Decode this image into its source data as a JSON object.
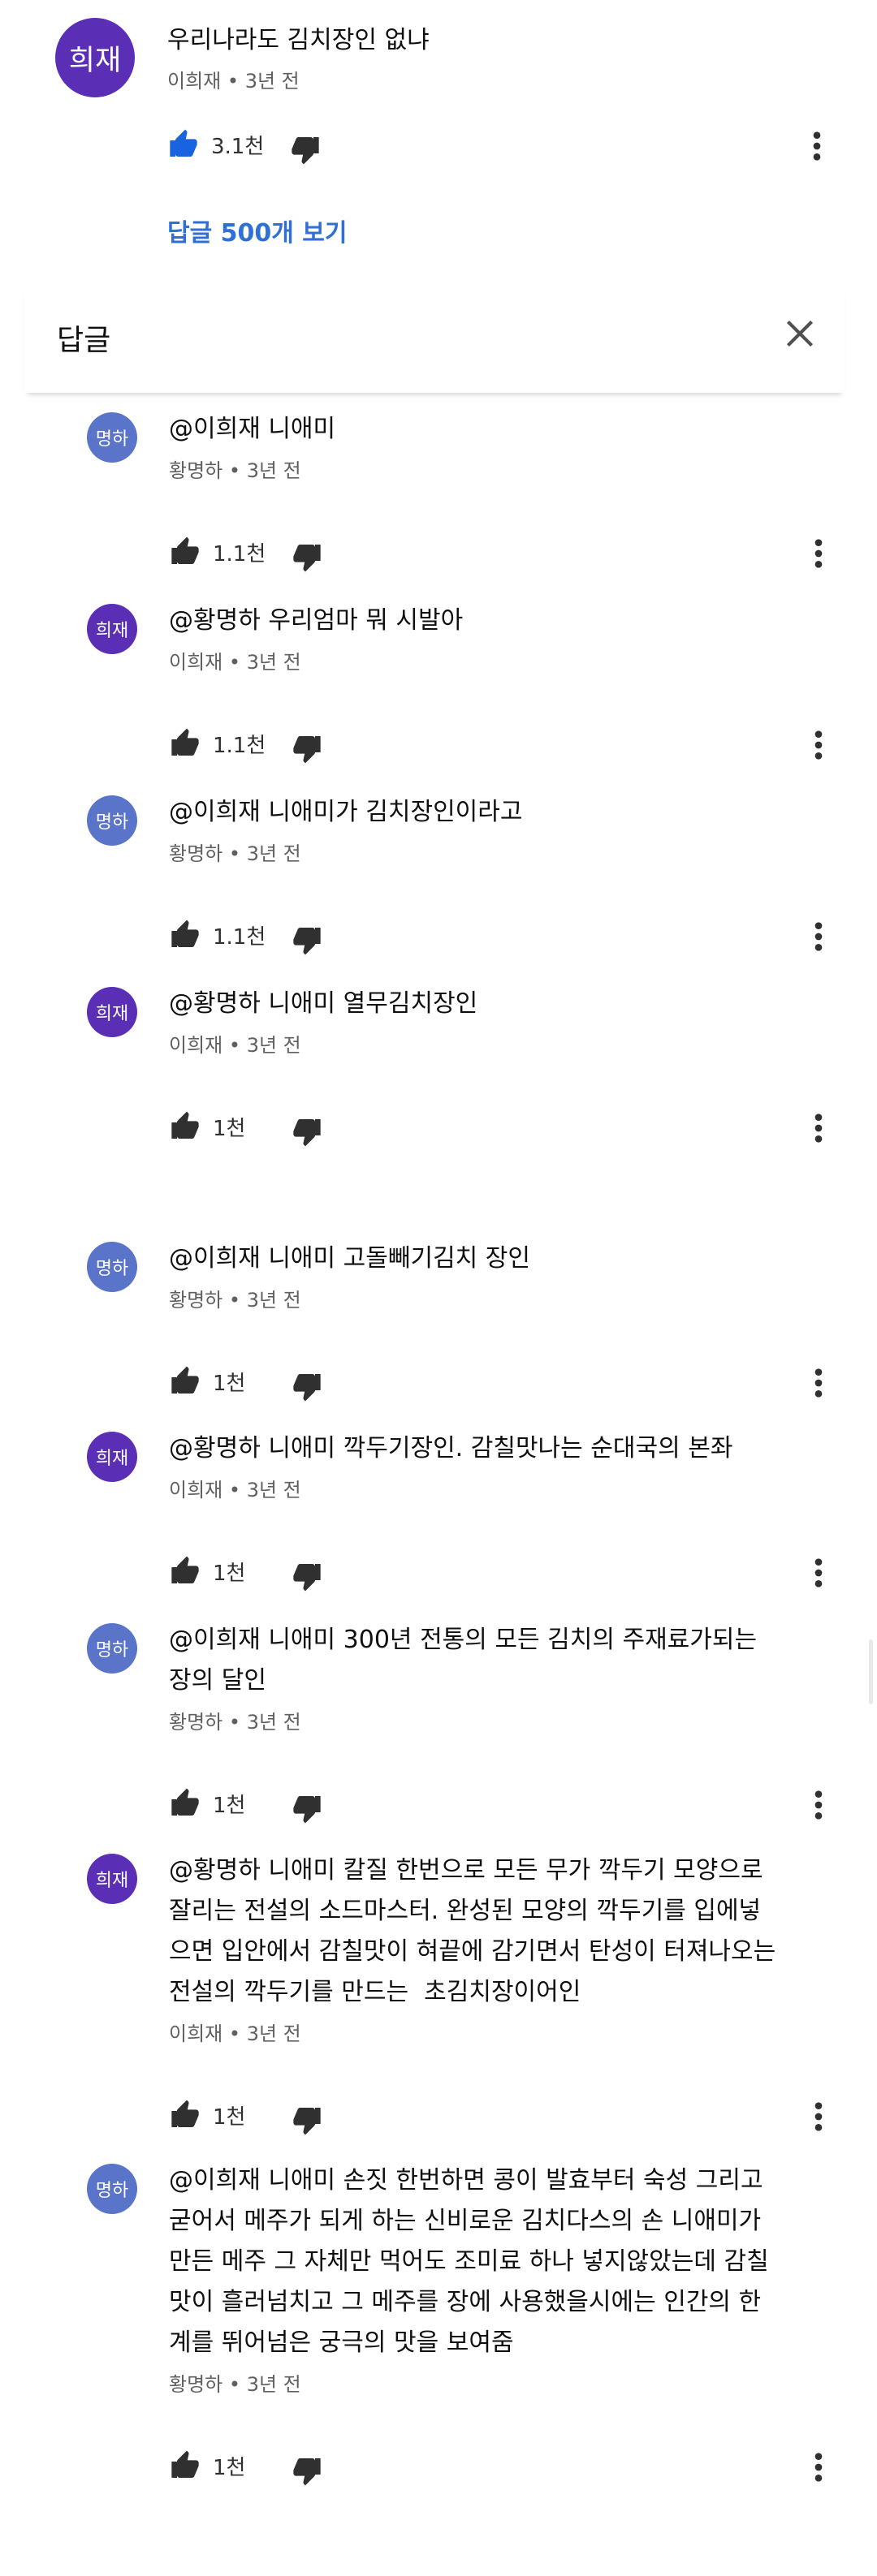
{
  "parent": {
    "avatar": "희재",
    "text": "우리나라도 김치장인 없냐",
    "author": "이희재",
    "time": "3년 전",
    "likes": "3.1천",
    "view_replies": "답글 500개 보기"
  },
  "header": {
    "title": "답글"
  },
  "replies": [
    {
      "avatar": "명하",
      "color": "blue",
      "text": "@이희재 니애미",
      "author": "황명하",
      "time": "3년 전",
      "likes": "1.1천"
    },
    {
      "avatar": "희재",
      "color": "purple",
      "text": "@황명하 우리엄마 뭐 시발아",
      "author": "이희재",
      "time": "3년 전",
      "likes": "1.1천"
    },
    {
      "avatar": "명하",
      "color": "blue",
      "text": "@이희재 니애미가 김치장인이라고",
      "author": "황명하",
      "time": "3년 전",
      "likes": "1.1천"
    },
    {
      "avatar": "희재",
      "color": "purple",
      "text": "@황명하 니애미 열무김치장인",
      "author": "이희재",
      "time": "3년 전",
      "likes": "1천"
    },
    {
      "avatar": "명하",
      "color": "blue",
      "text": "@이희재 니애미 고돌빼기김치 장인",
      "author": "황명하",
      "time": "3년 전",
      "likes": "1천"
    },
    {
      "avatar": "희재",
      "color": "purple",
      "text": "@황명하 니애미 깍두기장인. 감칠맛나는 순대국의 본좌",
      "author": "이희재",
      "time": "3년 전",
      "likes": "1천"
    },
    {
      "avatar": "명하",
      "color": "blue",
      "text": "@이희재 니애미 300년 전통의 모든 김치의 주재료가되는\n장의 달인",
      "author": "황명하",
      "time": "3년 전",
      "likes": "1천"
    },
    {
      "avatar": "희재",
      "color": "purple",
      "text": "@황명하 니애미 칼질 한번으로 모든 무가 깍두기 모양으로\n잘리는 전설의 소드마스터. 완성된 모양의 깍두기를 입에넣\n으면 입안에서 감칠맛이 혀끝에 감기면서 탄성이 터져나오는\n전설의 깍두기를 만드는  초김치장이어인",
      "author": "이희재",
      "time": "3년 전",
      "likes": "1천"
    },
    {
      "avatar": "명하",
      "color": "blue",
      "text": "@이희재 니애미 손짓 한번하면 콩이 발효부터 숙성 그리고\n굳어서 메주가 되게 하는 신비로운 김치다스의 손 니애미가\n만든 메주 그 자체만 먹어도 조미료 하나 넣지않았는데 감칠\n맛이 흘러넘치고 그 메주를 장에 사용했을시에는 인간의 한\n계를 뛰어넘은 궁극의 맛을 보여줌",
      "author": "황명하",
      "time": "3년 전",
      "likes": "1천"
    }
  ],
  "colors": {
    "accent_link": "#2f6fd6",
    "like_active": "#1a63e0",
    "avatar_purple": "#5a2fb5",
    "avatar_blue": "#5a74c9"
  }
}
